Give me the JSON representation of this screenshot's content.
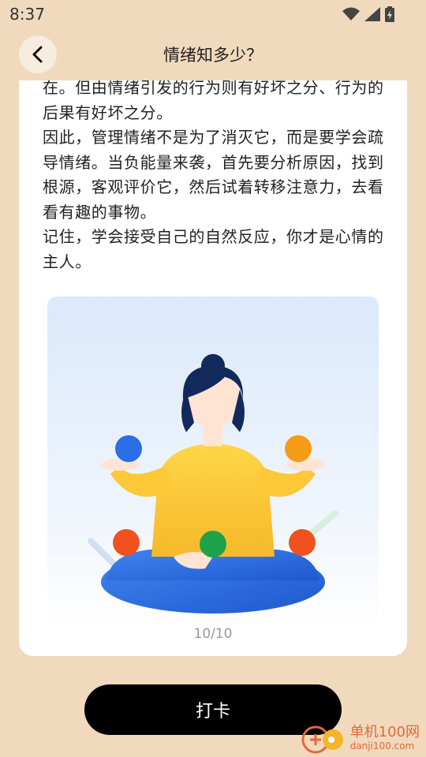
{
  "status": {
    "time": "8:37",
    "icons": [
      "wifi-icon",
      "signal-icon",
      "battery-icon"
    ]
  },
  "header": {
    "title": "情绪知多少？",
    "back_icon": "chevron-left-icon"
  },
  "article": {
    "paragraphs": [
      "在。但由情绪引发的行为则有好坏之分、行为的后果有好坏之分。",
      "因此，管理情绪不是为了消灭它，而是要学会疏导情绪。当负能量来袭，首先要分析原因，找到根源，客观评价它，然后试着转移注意力，去看看有趣的事物。",
      "记住，学会接受自己的自然反应，你才是心情的主人。"
    ]
  },
  "pager": {
    "indicator": "10/10"
  },
  "actions": {
    "checkin_label": "打卡"
  },
  "watermark": {
    "name": "单机100网",
    "url": "danji100.com"
  },
  "colors": {
    "background": "#f0d9bd",
    "card": "#ffffff",
    "button": "#000000",
    "shirt": "#fcc838",
    "pants": "#2f6fe0",
    "hair": "#12295c"
  }
}
